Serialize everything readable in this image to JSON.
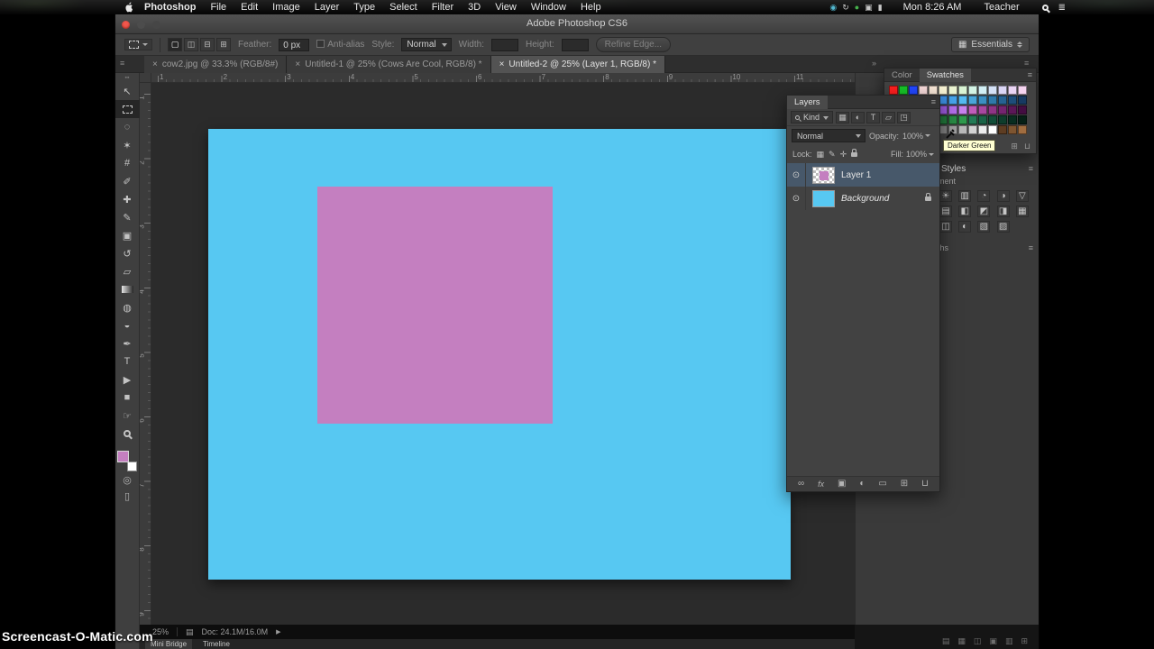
{
  "menu_bar": {
    "app_name": "Photoshop",
    "menus": [
      "File",
      "Edit",
      "Image",
      "Layer",
      "Type",
      "Select",
      "Filter",
      "3D",
      "View",
      "Window",
      "Help"
    ],
    "status_icons": [
      {
        "name": "screen-share-status-icon",
        "glyph": "◉",
        "color": "#52b8d0"
      },
      {
        "name": "sync-status-icon",
        "glyph": "↻",
        "color": "#c9c9c9"
      },
      {
        "name": "record-status-icon",
        "glyph": "●",
        "color": "#46b14c"
      },
      {
        "name": "display-status-icon",
        "glyph": "▣",
        "color": "#c9c9c9"
      },
      {
        "name": "battery-status-icon",
        "glyph": "▮",
        "color": "#c9c9c9"
      }
    ],
    "clock": "Mon 8:26 AM",
    "user_name": "Teacher"
  },
  "window": {
    "title": "Adobe Photoshop CS6"
  },
  "options_bar": {
    "mode_icons": [
      {
        "name": "new-selection-icon",
        "glyph": "▢",
        "active": true
      },
      {
        "name": "add-selection-icon",
        "glyph": "◫"
      },
      {
        "name": "subtract-selection-icon",
        "glyph": "⊟"
      },
      {
        "name": "intersect-selection-icon",
        "glyph": "⊞"
      }
    ],
    "feather_label": "Feather:",
    "feather_value": "0 px",
    "anti_alias_label": "Anti-alias",
    "style_label": "Style:",
    "style_value": "Normal",
    "width_label": "Width:",
    "height_label": "Height:",
    "refine_edge_label": "Refine Edge...",
    "workspace_label": "Essentials"
  },
  "doc_tabs": [
    {
      "label": "cow2.jpg @ 33.3% (RGB/8#)",
      "active": false
    },
    {
      "label": "Untitled-1 @ 25% (Cows Are Cool, RGB/8) *",
      "active": false
    },
    {
      "label": "Untitled-2 @ 25% (Layer 1, RGB/8) *",
      "active": true
    }
  ],
  "rulers": {
    "horizontal": [
      "1",
      "2",
      "3",
      "4",
      "5",
      "6",
      "7",
      "8",
      "9",
      "10",
      "11"
    ],
    "vertical": [
      "1",
      "2",
      "3",
      "4",
      "5",
      "6",
      "7",
      "8",
      "9"
    ]
  },
  "toolbar": {
    "tools": [
      {
        "name": "move-tool",
        "glyph": "↖"
      },
      {
        "name": "rectangular-marquee-tool",
        "shape": "dashedbox",
        "active": true
      },
      {
        "name": "lasso-tool",
        "glyph": "◌"
      },
      {
        "name": "quick-selection-tool",
        "glyph": "✶"
      },
      {
        "name": "crop-tool",
        "glyph": "#"
      },
      {
        "name": "eyedropper-tool",
        "glyph": "✐"
      },
      {
        "name": "healing-brush-tool",
        "glyph": "✚"
      },
      {
        "name": "brush-tool",
        "glyph": "✎"
      },
      {
        "name": "clone-stamp-tool",
        "glyph": "▣"
      },
      {
        "name": "history-brush-tool",
        "glyph": "↺"
      },
      {
        "name": "eraser-tool",
        "glyph": "▱"
      },
      {
        "name": "gradient-tool",
        "shape": "gradbox"
      },
      {
        "name": "blur-tool",
        "glyph": "◍"
      },
      {
        "name": "dodge-tool",
        "glyph": "◒"
      },
      {
        "name": "pen-tool",
        "glyph": "✒"
      },
      {
        "name": "type-tool",
        "glyph": "T"
      },
      {
        "name": "path-selection-tool",
        "glyph": "▶"
      },
      {
        "name": "rectangle-tool",
        "glyph": "■"
      },
      {
        "name": "hand-tool",
        "glyph": "☞"
      },
      {
        "name": "zoom-tool",
        "shape": "magnifier"
      }
    ],
    "extra_tools": [
      {
        "name": "quick-mask-button",
        "glyph": "◎"
      },
      {
        "name": "screen-mode-button",
        "glyph": "▯"
      }
    ]
  },
  "canvas": {
    "background_color": "#57c8f2",
    "square_color": "#c47fc0",
    "foreground_color": "#c47fc0"
  },
  "panels": {
    "swatches": {
      "tabs": [
        "Color",
        "Swatches"
      ],
      "tooltip": "Darker Green",
      "buttons": [
        {
          "name": "new-swatch-button",
          "glyph": "⊞"
        },
        {
          "name": "delete-swatch-button",
          "glyph": "⊔"
        }
      ],
      "palette": [
        "#ff1f1f",
        "#17c428",
        "#2247ff",
        "#f7dada",
        "#f7e6d6",
        "#f7f2d3",
        "#ebf4d2",
        "#d9f3d4",
        "#d3f3e5",
        "#d2eff5",
        "#d4e1f6",
        "#dad5f5",
        "#ead4f4",
        "#f5d4f0",
        "#24308e",
        "#273f9e",
        "#2a51b0",
        "#2f64c2",
        "#3579d4",
        "#3d8fe2",
        "#47a4ec",
        "#55baf2",
        "#4aa6da",
        "#3c8fc2",
        "#2f79aa",
        "#266292",
        "#1e4d7a",
        "#173a62",
        "#42207a",
        "#522a90",
        "#6434a6",
        "#7840bc",
        "#8c4cd2",
        "#a05ce2",
        "#b46eea",
        "#c882ee",
        "#c05cba",
        "#a847a0",
        "#8f3486",
        "#752470",
        "#5c1758",
        "#440d42",
        "#0c3315",
        "#104020",
        "#144d26",
        "#185c2d",
        "#1c6b34",
        "#227a3c",
        "#288a44",
        "#2f9a4d",
        "#237a55",
        "#1a6347",
        "#134e39",
        "#0e3d2c",
        "#092d20",
        "#062016",
        "#000000",
        "#1c1c1c",
        "#373737",
        "#515151",
        "#6b6b6b",
        "#858585",
        "#9f9f9f",
        "#b9b9b9",
        "#d3d3d3",
        "#ededed",
        "#ffffff",
        "#5e3d22",
        "#7e5530",
        "#a06d40"
      ]
    },
    "styles": {
      "title": "Styles"
    },
    "adjustments": {
      "tab_fragment": "ment",
      "icons": [
        {
          "name": "brightness-contrast-icon",
          "glyph": "☀"
        },
        {
          "name": "levels-icon",
          "glyph": "▥"
        },
        {
          "name": "curves-icon",
          "glyph": "◔"
        },
        {
          "name": "exposure-icon",
          "glyph": "◑"
        },
        {
          "name": "vibrance-icon",
          "glyph": "▽"
        },
        {
          "name": "hue-saturation-icon",
          "glyph": "▤"
        },
        {
          "name": "color-balance-icon",
          "glyph": "◧"
        },
        {
          "name": "black-white-icon",
          "glyph": "◩"
        },
        {
          "name": "photo-filter-icon",
          "glyph": "◨"
        },
        {
          "name": "channel-mixer-icon",
          "glyph": "▦"
        },
        {
          "name": "color-lookup-icon",
          "glyph": "◫"
        },
        {
          "name": "invert-icon",
          "glyph": "◐"
        },
        {
          "name": "posterize-icon",
          "glyph": "▧"
        },
        {
          "name": "threshold-icon",
          "glyph": "▨"
        }
      ]
    },
    "paths": {
      "tab_fragment": "ths"
    },
    "layers": {
      "title": "Layers",
      "kind_label": "Kind",
      "filter_icons": [
        {
          "name": "filter-pixel-layers-icon",
          "glyph": "▦"
        },
        {
          "name": "filter-adjustment-layers-icon",
          "glyph": "◐"
        },
        {
          "name": "filter-type-layers-icon",
          "glyph": "T"
        },
        {
          "name": "filter-shape-layers-icon",
          "glyph": "▱"
        },
        {
          "name": "filter-smart-objects-icon",
          "glyph": "◳"
        }
      ],
      "blend_mode": "Normal",
      "opacity_label": "Opacity:",
      "opacity_value": "100%",
      "lock_label": "Lock:",
      "lock_icons": [
        {
          "name": "lock-transparent-pixels-icon",
          "glyph": "▦"
        },
        {
          "name": "lock-image-pixels-icon",
          "glyph": "✎"
        },
        {
          "name": "lock-position-icon",
          "glyph": "✛"
        },
        {
          "name": "lock-all-icon",
          "shape": "padlock"
        }
      ],
      "fill_label": "Fill:",
      "fill_value": "100%",
      "layers": [
        {
          "name": "Layer 1",
          "selected": true,
          "thumb": "checker",
          "locked": false,
          "italic": false
        },
        {
          "name": "Background",
          "selected": false,
          "thumb": "solid",
          "locked": true,
          "italic": true
        }
      ],
      "bottom_icons": [
        {
          "name": "link-layers-icon",
          "glyph": "∞"
        },
        {
          "name": "layer-style-icon",
          "glyph": "fx"
        },
        {
          "name": "add-layer-mask-icon",
          "glyph": "▣"
        },
        {
          "name": "new-adjustment-layer-icon",
          "glyph": "◐"
        },
        {
          "name": "new-group-icon",
          "glyph": "▭"
        },
        {
          "name": "new-layer-icon",
          "glyph": "⊞"
        },
        {
          "name": "delete-layer-icon",
          "glyph": "⊔"
        }
      ]
    }
  },
  "status_bar": {
    "zoom": "25%",
    "doc_info": "Doc: 24.1M/16.0M"
  },
  "bottom_bar": {
    "tabs": [
      "Mini Bridge",
      "Timeline"
    ]
  },
  "footer_icons": [
    {
      "name": "taskbar-icon-1",
      "glyph": "▤"
    },
    {
      "name": "taskbar-icon-2",
      "glyph": "▦"
    },
    {
      "name": "taskbar-icon-3",
      "glyph": "◫"
    },
    {
      "name": "taskbar-icon-4",
      "glyph": "▣"
    },
    {
      "name": "taskbar-icon-5",
      "glyph": "▥"
    },
    {
      "name": "taskbar-icon-6",
      "glyph": "⊞"
    }
  ],
  "watermark": "Screencast-O-Matic.com",
  "glyphs": {
    "close": "×",
    "eye": "⊙",
    "panel_menu": "≡",
    "collapse_right": "»",
    "doc_icon": "▤",
    "play": "▶"
  }
}
